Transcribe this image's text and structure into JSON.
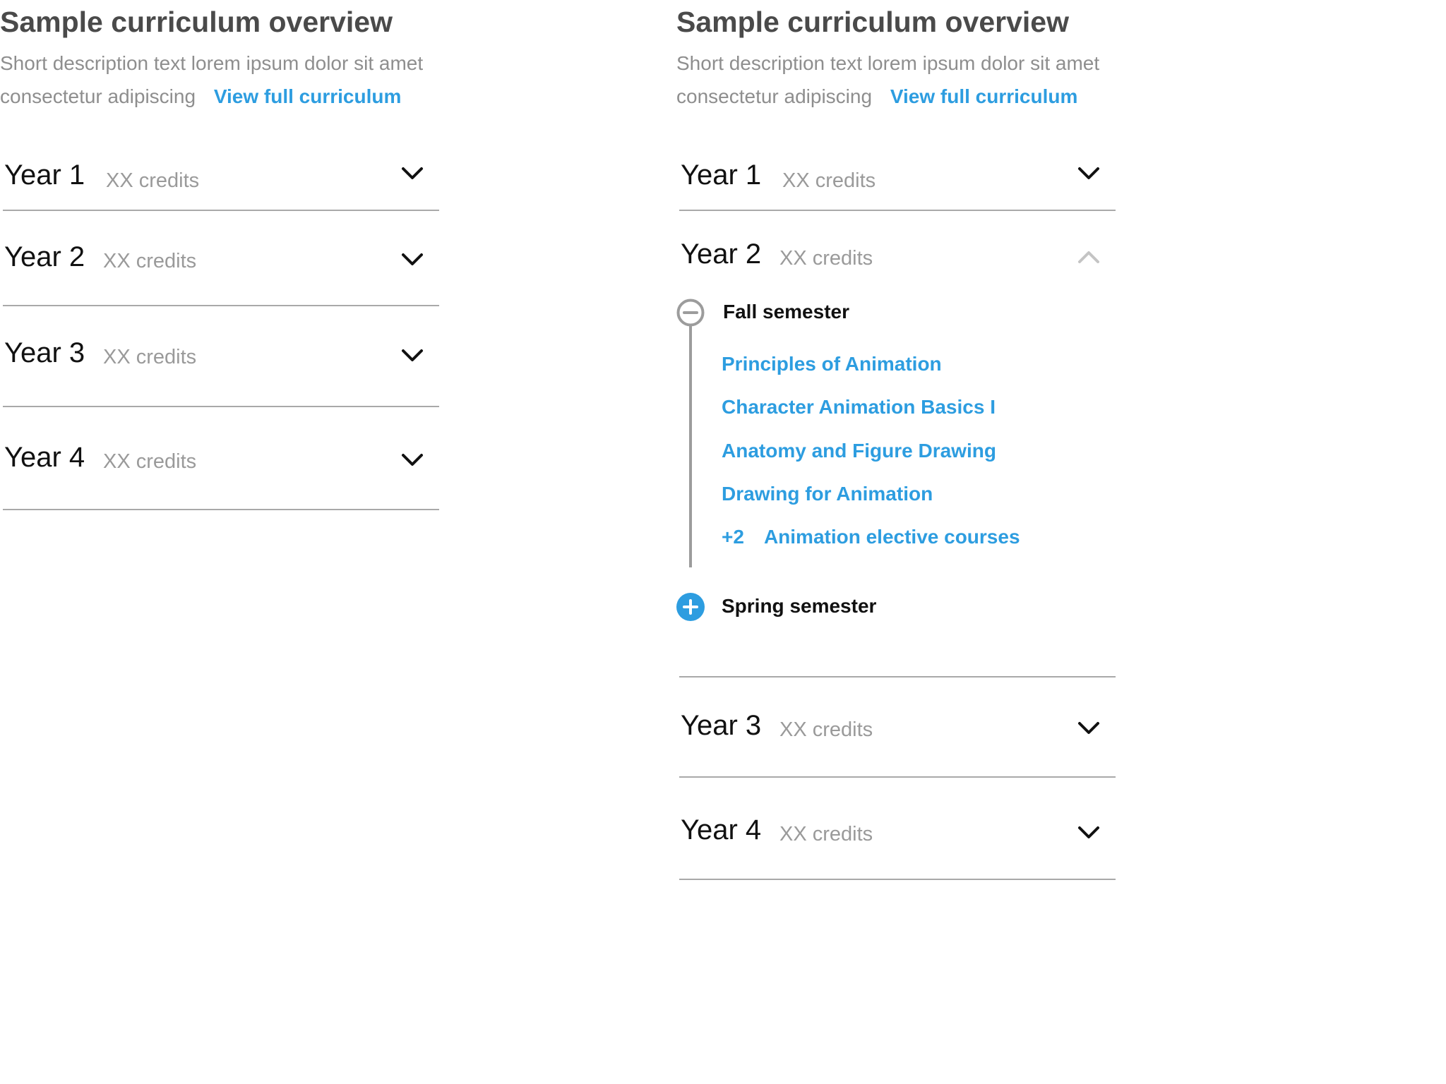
{
  "colors": {
    "accent": "#2d9de0",
    "title": "#4a4a4a",
    "muted": "#8e8e8e",
    "divider": "#a9a9a9",
    "text": "#111111"
  },
  "overview": {
    "title": "Sample curriculum overview",
    "description": "Short description text lorem ipsum dolor sit amet consectetur adipiscing",
    "link": "View full curriculum"
  },
  "collapsed_view": {
    "years": [
      {
        "label": "Year 1",
        "credits": "XX credits",
        "icon": "chevron-down-icon"
      },
      {
        "label": "Year 2",
        "credits": "XX credits",
        "icon": "chevron-down-icon"
      },
      {
        "label": "Year 3",
        "credits": "XX credits",
        "icon": "chevron-down-icon"
      },
      {
        "label": "Year 4",
        "credits": "XX credits",
        "icon": "chevron-down-icon"
      }
    ]
  },
  "expanded_view": {
    "years": [
      {
        "label": "Year 1",
        "credits": "XX credits",
        "icon": "chevron-down-icon"
      },
      {
        "label": "Year 2",
        "credits": "XX credits",
        "icon": "chevron-up-icon",
        "expanded": true
      },
      {
        "label": "Year 3",
        "credits": "XX credits",
        "icon": "chevron-down-icon"
      },
      {
        "label": "Year 4",
        "credits": "XX credits",
        "icon": "chevron-down-icon"
      }
    ],
    "fall_semester": {
      "label": "Fall semester",
      "icon": "minus-circle-icon",
      "courses": [
        "Principles of Animation",
        "Character Animation Basics I",
        "Anatomy and Figure Drawing",
        "Drawing for Animation"
      ],
      "electives": {
        "count": "+2",
        "label": "Animation elective courses"
      }
    },
    "spring_semester": {
      "label": "Spring semester",
      "icon": "plus-circle-icon"
    }
  }
}
